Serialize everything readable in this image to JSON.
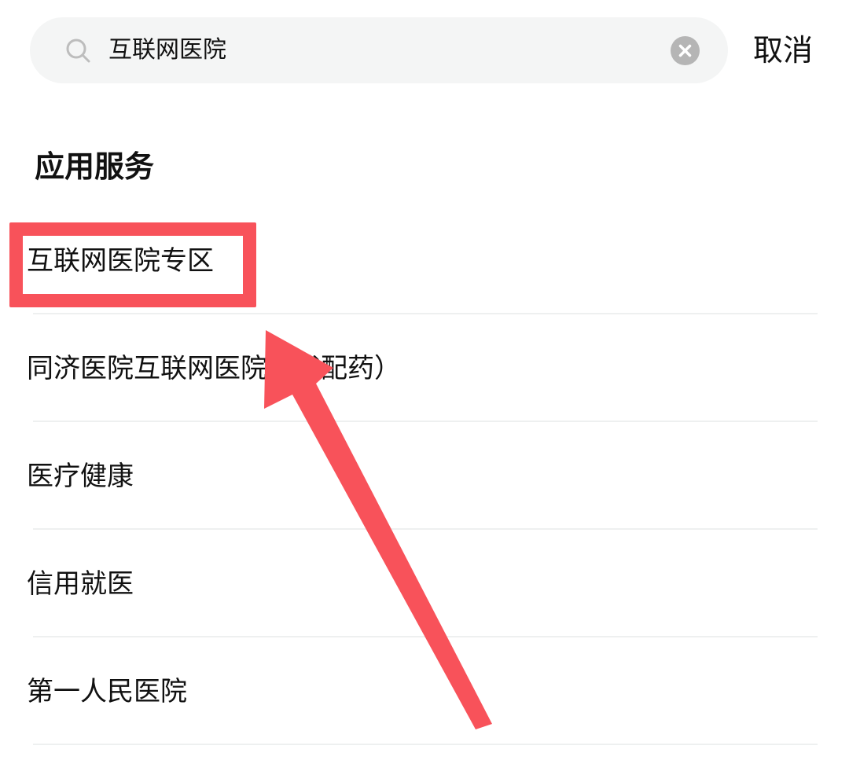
{
  "search": {
    "query": "互联网医院",
    "cancel_label": "取消"
  },
  "section": {
    "title": "应用服务"
  },
  "results": [
    {
      "label": "互联网医院专区"
    },
    {
      "label": "同济医院互联网医院（代配药）"
    },
    {
      "label": "医疗健康"
    },
    {
      "label": "信用就医"
    },
    {
      "label": "第一人民医院"
    }
  ],
  "icons": {
    "search": "search-icon",
    "clear": "clear-icon",
    "annotation": "red-arrow-annotation"
  },
  "colors": {
    "annotation_red": "#f8525a",
    "search_bg": "#f4f5f5",
    "clear_icon_bg": "#b5b5b5",
    "divider": "#eef0f0"
  }
}
